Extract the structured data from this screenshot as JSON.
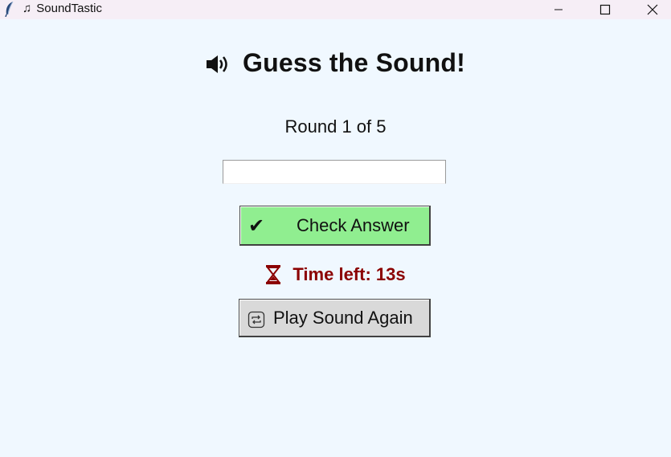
{
  "window": {
    "title": "SoundTastic",
    "title_icon": "music-note-icon",
    "app_icon": "feather-icon",
    "controls": [
      "minimize-icon",
      "maximize-icon",
      "close-icon"
    ]
  },
  "game": {
    "heading": "Guess the Sound!",
    "heading_icon": "speaker-icon",
    "round_text": "Round 1 of 5",
    "answer_value": "",
    "check_button_icon": "✔",
    "check_button_label": "Check Answer",
    "timer_icon": "hourglass-icon",
    "timer_text": "Time left: 13s",
    "play_again_icon": "repeat-icon",
    "play_again_label": "Play Sound Again"
  },
  "colors": {
    "background": "#f0f8ff",
    "check_button": "#90ee90",
    "play_button": "#d9d9d9",
    "timer_text": "#8b0000"
  }
}
